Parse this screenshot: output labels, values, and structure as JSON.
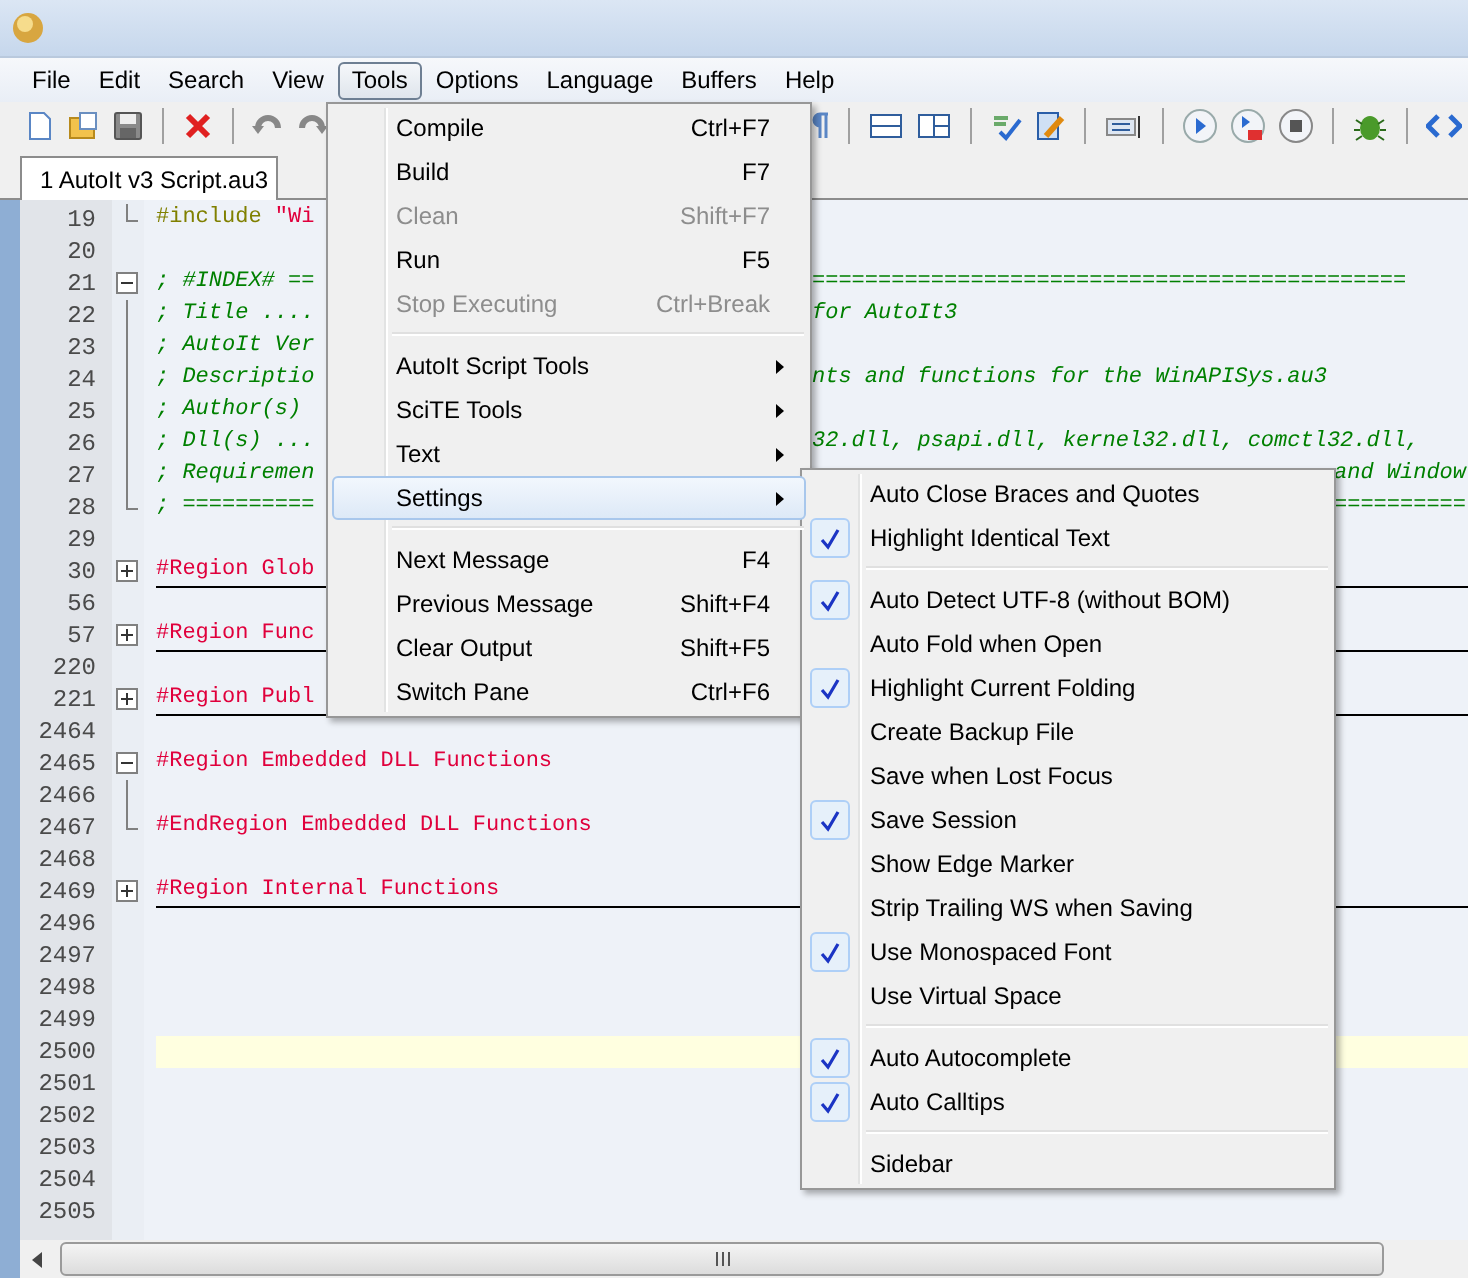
{
  "menubar": [
    {
      "label": "File",
      "selected": false
    },
    {
      "label": "Edit",
      "selected": false
    },
    {
      "label": "Search",
      "selected": false
    },
    {
      "label": "View",
      "selected": false
    },
    {
      "label": "Tools",
      "selected": true
    },
    {
      "label": "Options",
      "selected": false
    },
    {
      "label": "Language",
      "selected": false
    },
    {
      "label": "Buffers",
      "selected": false
    },
    {
      "label": "Help",
      "selected": false
    }
  ],
  "tabs": [
    {
      "label": "1 AutoIt v3 Script.au3",
      "selected": true
    }
  ],
  "editor": {
    "lines": [
      {
        "number": "19",
        "kind": "foldend",
        "current": false,
        "tokens": [
          {
            "kind": "directive",
            "text": "#include"
          },
          {
            "kind": "string",
            "text": " \"Wi"
          }
        ]
      },
      {
        "number": "20",
        "kind": "plain",
        "current": false
      },
      {
        "number": "21",
        "kind": "expanded",
        "current": false,
        "tokens": [
          {
            "kind": "comment",
            "text": "; #INDEX# =="
          }
        ],
        "right": "============================================="
      },
      {
        "number": "22",
        "kind": "foldbody",
        "current": false,
        "tokens": [
          {
            "kind": "comment",
            "text": "; Title ...."
          }
        ],
        "right": "for AutoIt3"
      },
      {
        "number": "23",
        "kind": "foldbody",
        "current": false,
        "tokens": [
          {
            "kind": "comment",
            "text": "; AutoIt Ver"
          }
        ]
      },
      {
        "number": "24",
        "kind": "foldbody",
        "current": false,
        "tokens": [
          {
            "kind": "comment",
            "text": "; Descriptio"
          }
        ],
        "right": "nts and functions for the WinAPISys.au3"
      },
      {
        "number": "25",
        "kind": "foldbody",
        "current": false,
        "tokens": [
          {
            "kind": "comment",
            "text": "; Author(s)"
          }
        ]
      },
      {
        "number": "26",
        "kind": "foldbody",
        "current": false,
        "tokens": [
          {
            "kind": "comment",
            "text": "; Dll(s) ..."
          }
        ],
        "right": "32.dll, psapi.dll, kernel32.dll, comctl32.dll,"
      },
      {
        "number": "27",
        "kind": "foldbody",
        "current": false,
        "tokens": [
          {
            "kind": "comment",
            "text": "; Requiremen"
          }
        ],
        "far": "and Window"
      },
      {
        "number": "28",
        "kind": "foldend",
        "current": false,
        "tokens": [
          {
            "kind": "comment",
            "text": "; =========="
          }
        ],
        "far": "=========="
      },
      {
        "number": "29",
        "kind": "plain",
        "current": false
      },
      {
        "number": "30",
        "kind": "collapsed",
        "current": false,
        "tokens": [
          {
            "kind": "region",
            "text": "#Region Glob"
          }
        ]
      },
      {
        "number": "56",
        "kind": "plain",
        "current": false
      },
      {
        "number": "57",
        "kind": "collapsed",
        "current": false,
        "tokens": [
          {
            "kind": "region",
            "text": "#Region Func"
          }
        ]
      },
      {
        "number": "220",
        "kind": "plain",
        "current": false
      },
      {
        "number": "221",
        "kind": "collapsed",
        "current": false,
        "tokens": [
          {
            "kind": "region",
            "text": "#Region Publ"
          }
        ]
      },
      {
        "number": "2464",
        "kind": "plain",
        "current": false
      },
      {
        "number": "2465",
        "kind": "expanded",
        "current": false,
        "tokens": [
          {
            "kind": "region",
            "text": "#Region Embedded DLL Functions"
          }
        ]
      },
      {
        "number": "2466",
        "kind": "foldbody",
        "current": false
      },
      {
        "number": "2467",
        "kind": "foldend",
        "current": false,
        "tokens": [
          {
            "kind": "region",
            "text": "#EndRegion Embedded DLL Functions"
          }
        ]
      },
      {
        "number": "2468",
        "kind": "plain",
        "current": false
      },
      {
        "number": "2469",
        "kind": "collapsed",
        "current": false,
        "tokens": [
          {
            "kind": "region",
            "text": "#Region Internal Functions"
          }
        ]
      },
      {
        "number": "2496",
        "kind": "plain",
        "current": false
      },
      {
        "number": "2497",
        "kind": "plain",
        "current": false
      },
      {
        "number": "2498",
        "kind": "plain",
        "current": false
      },
      {
        "number": "2499",
        "kind": "plain",
        "current": false
      },
      {
        "number": "2500",
        "kind": "plain",
        "current": true
      },
      {
        "number": "2501",
        "kind": "plain",
        "current": false
      },
      {
        "number": "2502",
        "kind": "plain",
        "current": false
      },
      {
        "number": "2503",
        "kind": "plain",
        "current": false
      },
      {
        "number": "2504",
        "kind": "plain",
        "current": false
      },
      {
        "number": "2505",
        "kind": "plain",
        "current": false
      }
    ]
  },
  "tools_menu": [
    {
      "kind": "command",
      "label": "Compile",
      "shortcut": "Ctrl+F7",
      "disabled": false,
      "selected": false
    },
    {
      "kind": "command",
      "label": "Build",
      "shortcut": "F7",
      "disabled": false,
      "selected": false
    },
    {
      "kind": "command",
      "label": "Clean",
      "shortcut": "Shift+F7",
      "disabled": true,
      "selected": false
    },
    {
      "kind": "command",
      "label": "Run",
      "shortcut": "F5",
      "disabled": false,
      "selected": false
    },
    {
      "kind": "command",
      "label": "Stop Executing",
      "shortcut": "Ctrl+Break",
      "disabled": true,
      "selected": false
    },
    {
      "kind": "separator"
    },
    {
      "kind": "submenu",
      "label": "AutoIt Script Tools",
      "selected": false
    },
    {
      "kind": "submenu",
      "label": "SciTE Tools",
      "selected": false
    },
    {
      "kind": "submenu",
      "label": "Text",
      "selected": false
    },
    {
      "kind": "submenu",
      "label": "Settings",
      "selected": true
    },
    {
      "kind": "separator"
    },
    {
      "kind": "command",
      "label": "Next Message",
      "shortcut": "F4",
      "disabled": false,
      "selected": false
    },
    {
      "kind": "command",
      "label": "Previous Message",
      "shortcut": "Shift+F4",
      "disabled": false,
      "selected": false
    },
    {
      "kind": "command",
      "label": "Clear Output",
      "shortcut": "Shift+F5",
      "disabled": false,
      "selected": false
    },
    {
      "kind": "command",
      "label": "Switch Pane",
      "shortcut": "Ctrl+F6",
      "disabled": false,
      "selected": false
    }
  ],
  "settings_menu": [
    {
      "kind": "check",
      "label": "Auto Close Braces and Quotes",
      "checked": false
    },
    {
      "kind": "check",
      "label": "Highlight Identical Text",
      "checked": true
    },
    {
      "kind": "separator"
    },
    {
      "kind": "check",
      "label": "Auto Detect UTF-8 (without BOM)",
      "checked": true
    },
    {
      "kind": "check",
      "label": "Auto Fold when Open",
      "checked": false
    },
    {
      "kind": "check",
      "label": "Highlight Current Folding",
      "checked": true
    },
    {
      "kind": "check",
      "label": "Create Backup File",
      "checked": false
    },
    {
      "kind": "check",
      "label": "Save when Lost Focus",
      "checked": false
    },
    {
      "kind": "check",
      "label": "Save Session",
      "checked": true
    },
    {
      "kind": "check",
      "label": "Show Edge Marker",
      "checked": false
    },
    {
      "kind": "check",
      "label": "Strip Trailing WS when Saving",
      "checked": false
    },
    {
      "kind": "check",
      "label": "Use Monospaced Font",
      "checked": true
    },
    {
      "kind": "check",
      "label": "Use Virtual Space",
      "checked": false
    },
    {
      "kind": "separator"
    },
    {
      "kind": "check",
      "label": "Auto Autocomplete",
      "checked": true
    },
    {
      "kind": "check",
      "label": "Auto Calltips",
      "checked": true
    },
    {
      "kind": "separator"
    },
    {
      "kind": "check",
      "label": "Sidebar",
      "checked": false
    }
  ]
}
